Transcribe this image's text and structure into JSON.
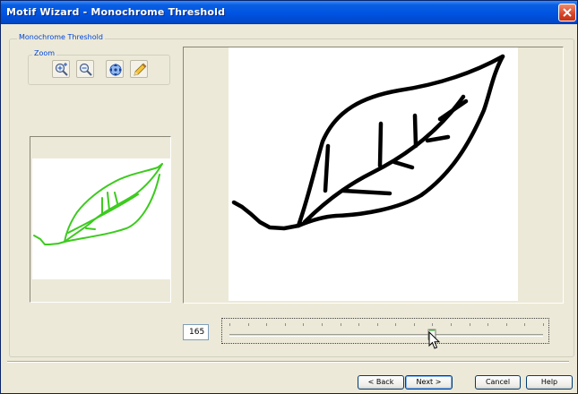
{
  "window": {
    "title": "Motif Wizard - Monochrome Threshold"
  },
  "group": {
    "label": "Monochrome Threshold"
  },
  "zoom": {
    "label": "Zoom",
    "tools": [
      {
        "name": "zoom-in-icon"
      },
      {
        "name": "zoom-out-icon"
      },
      {
        "name": "pan-icon"
      },
      {
        "name": "pencil-icon"
      }
    ]
  },
  "threshold": {
    "value": "165",
    "slider_min": 0,
    "slider_max": 255,
    "slider_value": 165,
    "tick_count": 18
  },
  "buttons": {
    "back": "< Back",
    "next": "Next >",
    "cancel": "Cancel",
    "help": "Help"
  },
  "colors": {
    "titlebar": "#0054E3",
    "group_label": "#0046D5",
    "preview_stroke": "#3CCB1E",
    "mono_stroke": "#000000"
  }
}
